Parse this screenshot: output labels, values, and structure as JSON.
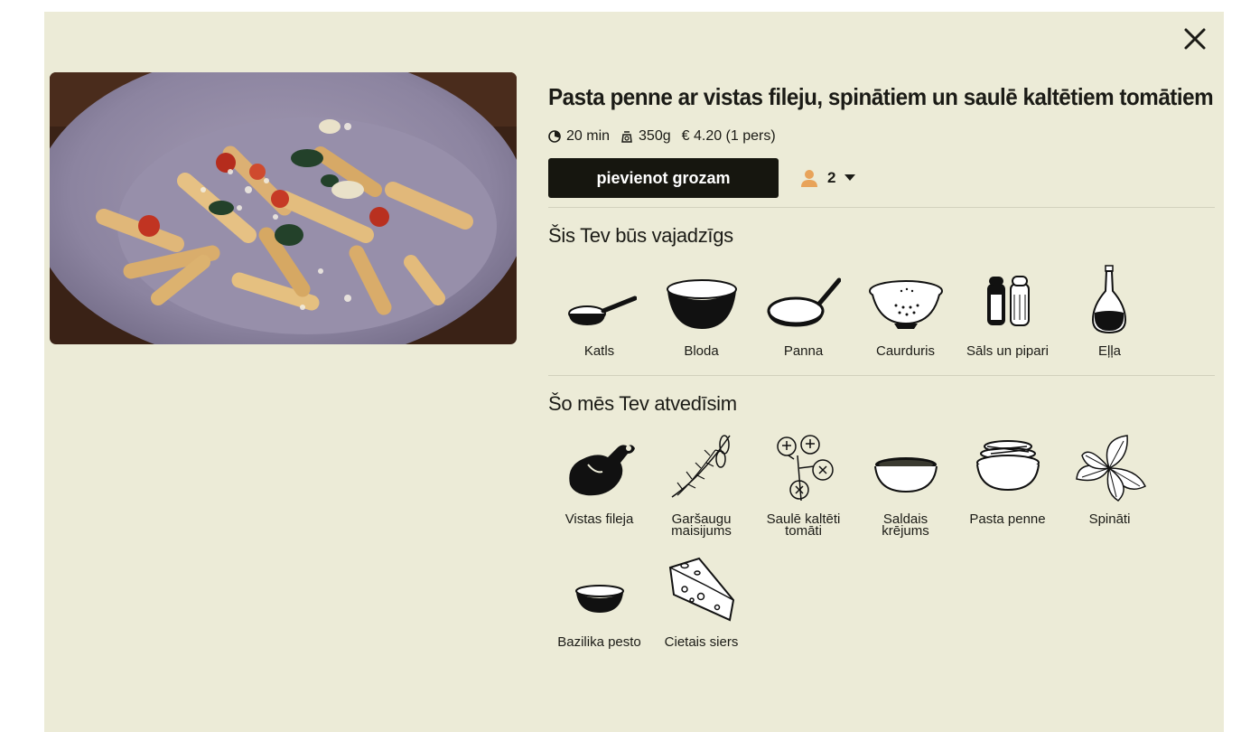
{
  "recipe": {
    "title": "Pasta penne ar vistas fileju, spinātiem un saulē kaltētiem tomātiem",
    "time": "20 min",
    "weight": "350g",
    "price": "€ 4.20 (1 pers)"
  },
  "actions": {
    "add_to_cart": "pievienot grozam",
    "portions": "2"
  },
  "tools": {
    "heading": "Šis Tev būs vajadzīgs",
    "items": [
      {
        "label": "Katls",
        "icon": "saucepan-icon"
      },
      {
        "label": "Bloda",
        "icon": "bowl-icon"
      },
      {
        "label": "Panna",
        "icon": "frying-pan-icon"
      },
      {
        "label": "Caurduris",
        "icon": "colander-icon"
      },
      {
        "label": "Sāls un pipari",
        "icon": "salt-pepper-icon"
      },
      {
        "label": "Eļļa",
        "icon": "oil-bottle-icon"
      }
    ]
  },
  "ingredients": {
    "heading": "Šo mēs Tev atvedīsim",
    "items": [
      {
        "label": "Vistas fileja",
        "icon": "chicken-icon"
      },
      {
        "label": "Garšaugu\nmaisijums",
        "icon": "herbs-icon"
      },
      {
        "label": "Saulē kaltēti\ntomāti",
        "icon": "tomatoes-icon"
      },
      {
        "label": "Saldais\nkrējums",
        "icon": "cream-bowl-icon"
      },
      {
        "label": "Pasta penne",
        "icon": "pasta-bowl-icon"
      },
      {
        "label": "Spināti",
        "icon": "spinach-icon"
      },
      {
        "label": "Bazilika pesto",
        "icon": "pesto-bowl-icon"
      },
      {
        "label": "Cietais siers",
        "icon": "cheese-icon"
      }
    ]
  },
  "colors": {
    "background": "#ecebd7",
    "button": "#16160f",
    "accent_person": "#e8a35a"
  }
}
